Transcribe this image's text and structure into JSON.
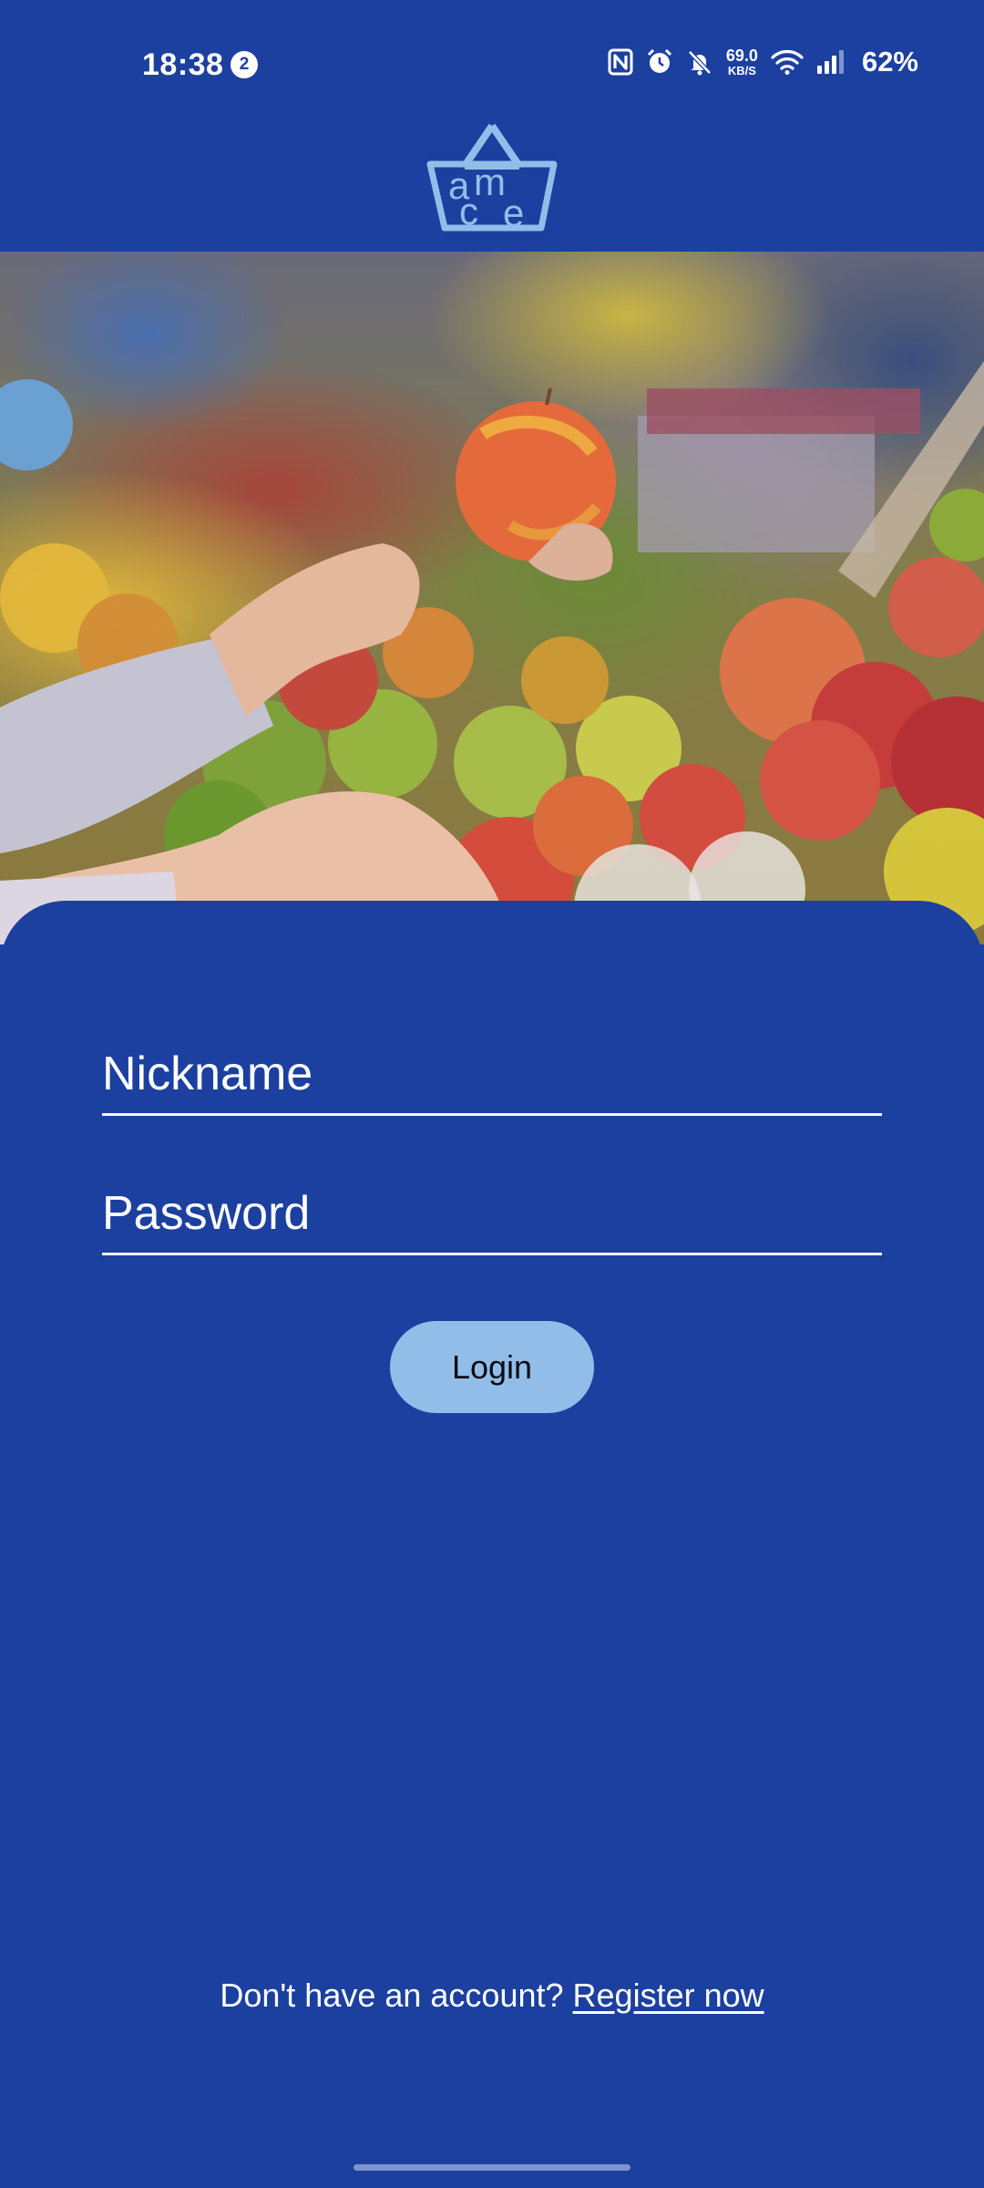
{
  "status_bar": {
    "time": "18:38",
    "notification_count": "2",
    "net_speed_value": "69.0",
    "net_speed_unit": "KB/S",
    "battery": "62%",
    "icons": [
      "nfc-icon",
      "alarm-icon",
      "bell-muted-icon",
      "wifi-icon",
      "signal-icon"
    ]
  },
  "logo": {
    "letters": [
      "a",
      "m",
      "c",
      "e"
    ],
    "color": "#92bde8"
  },
  "hero": {
    "image": "hand-picking-apple-market-photo"
  },
  "form": {
    "nickname_placeholder": "Nickname",
    "password_placeholder": "Password",
    "login_label": "Login"
  },
  "footer": {
    "prompt": "Don't have an account?",
    "register_label": "Register now"
  },
  "colors": {
    "background": "#1c40a0",
    "button": "#92bde8",
    "text": "#ffffff"
  }
}
